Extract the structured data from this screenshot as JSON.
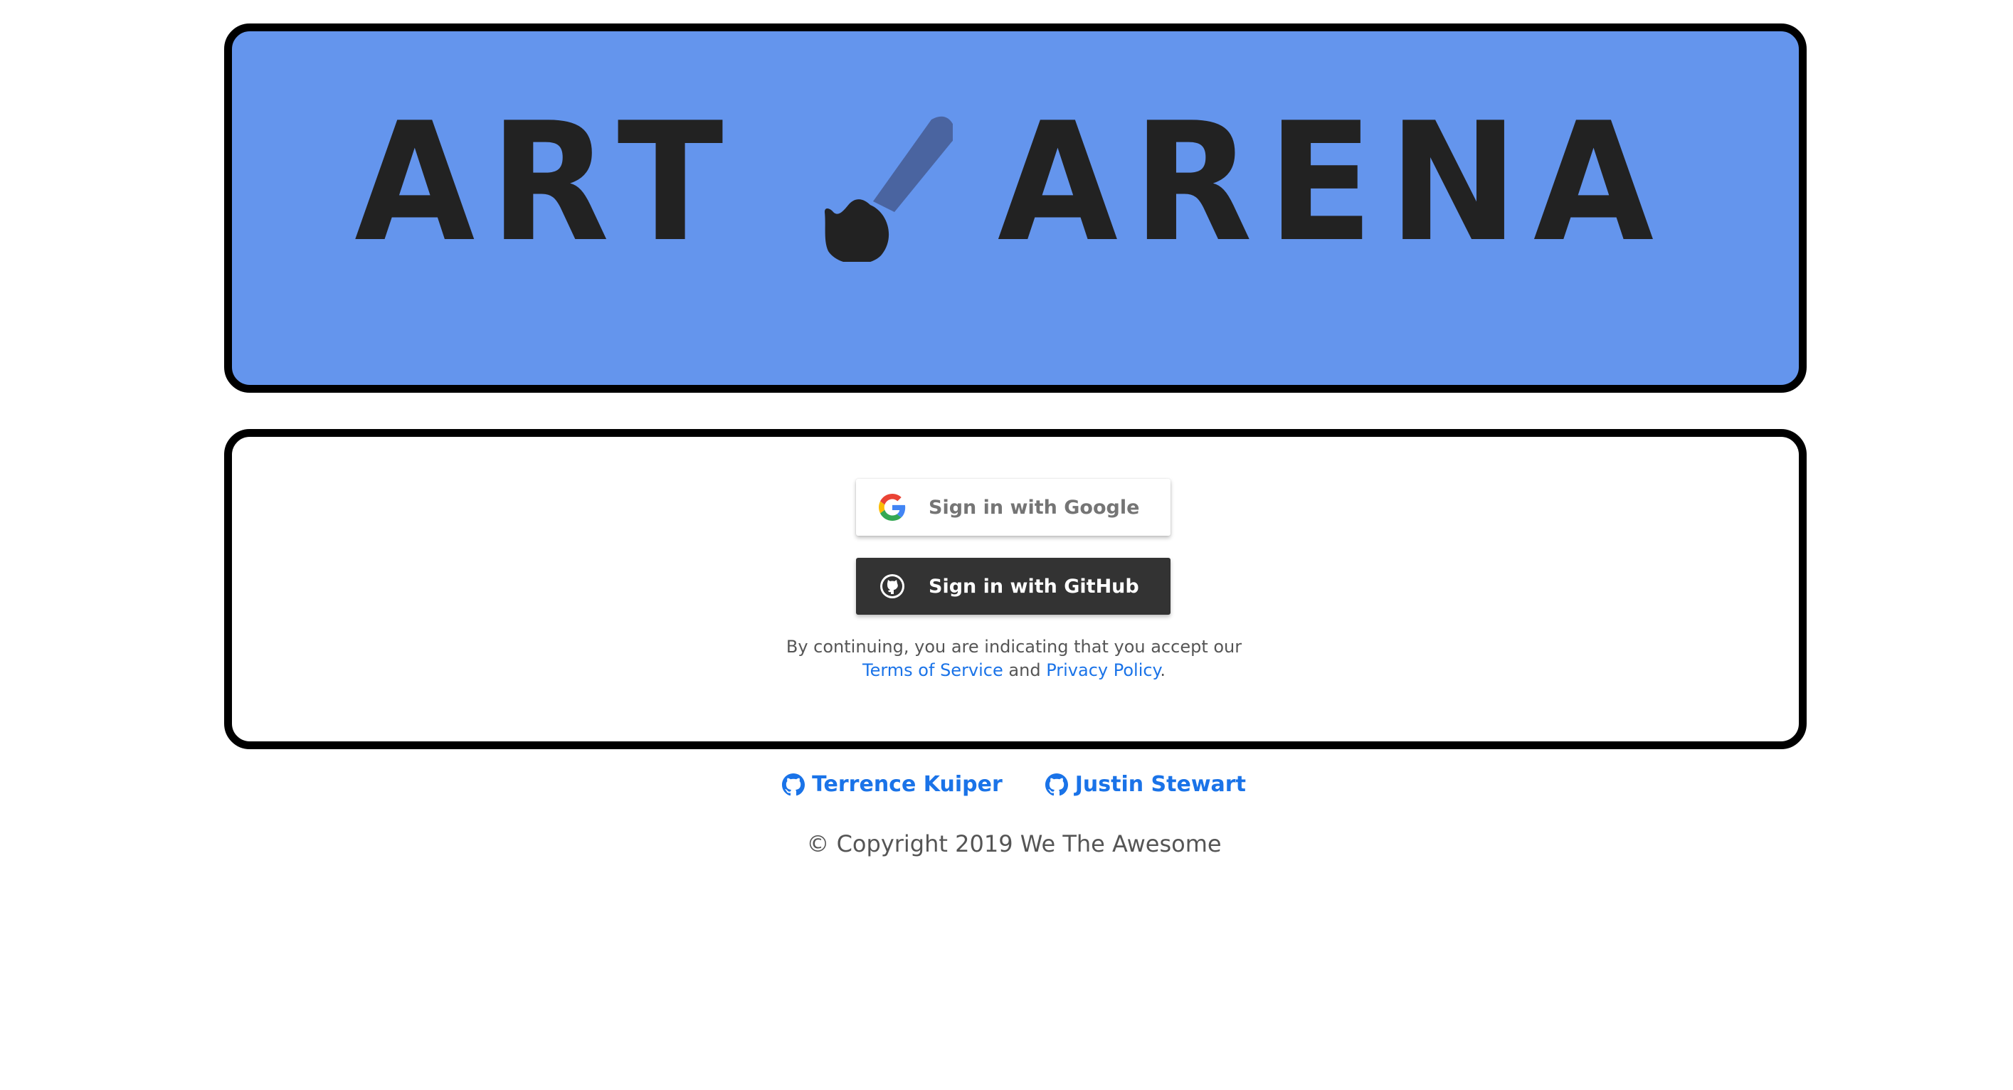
{
  "banner": {
    "title_left": "ART",
    "title_right": "ARENA",
    "logo_icon": "paintbrush-icon",
    "background": "#6495ED"
  },
  "auth": {
    "google_label": "Sign in with Google",
    "google_icon": "google-icon",
    "github_label": "Sign in with GitHub",
    "github_icon": "github-icon",
    "terms_prefix": "By continuing, you are indicating that you accept our",
    "terms_link": "Terms of Service",
    "terms_and": "and",
    "privacy_link": "Privacy Policy",
    "terms_suffix": "."
  },
  "footer": {
    "authors": [
      {
        "name": "Terrence Kuiper",
        "icon": "github-icon"
      },
      {
        "name": "Justin Stewart",
        "icon": "github-icon"
      }
    ],
    "copyright": "© Copyright 2019 We The Awesome",
    "link_color": "#1a73e8"
  }
}
